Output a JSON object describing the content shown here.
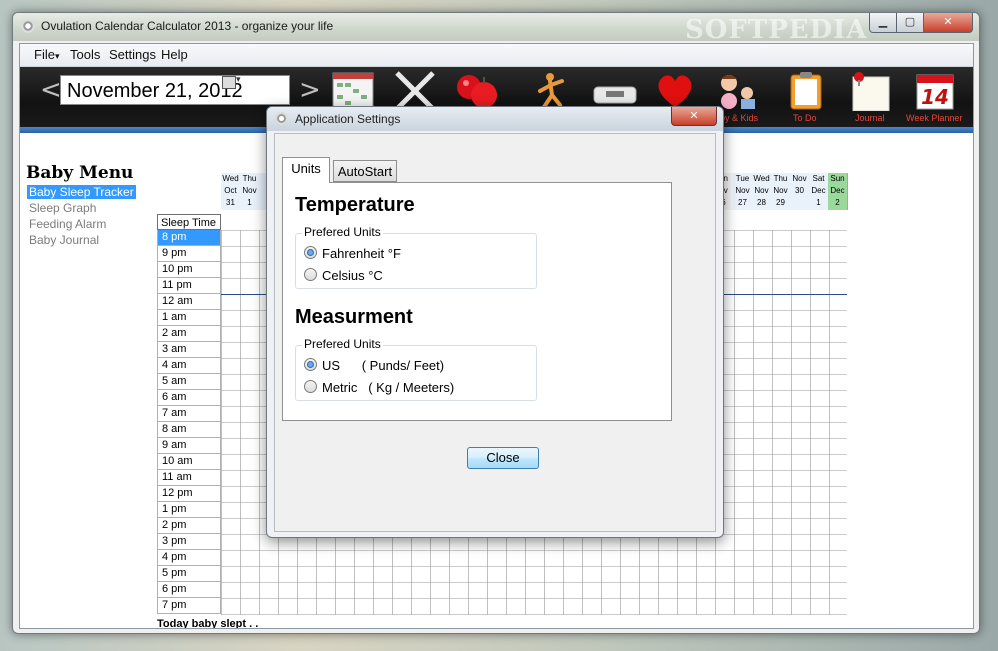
{
  "window": {
    "title": "Ovulation Calendar Calculator 2013 - organize your life",
    "watermark": "SOFTPEDIA",
    "controls": {
      "minimize": "▁",
      "maximize": "▢",
      "close": "✕"
    }
  },
  "menu": [
    "File",
    "Tools",
    "Settings",
    "Help"
  ],
  "file_arrow": "▾",
  "date_nav": {
    "prev": "<",
    "next": ">",
    "date": "November  21, 2012",
    "dropdown": "▾"
  },
  "toolbar": [
    {
      "icon": "calendar-grid-icon",
      "label": ""
    },
    {
      "icon": "cross-icon",
      "label": ""
    },
    {
      "icon": "apples-icon",
      "label": ""
    },
    {
      "icon": "exercise-figure-icon",
      "label": ""
    },
    {
      "icon": "scale-icon",
      "label": ""
    },
    {
      "icon": "heart-icon",
      "label": ""
    },
    {
      "icon": "baby-kids-icon",
      "label": "by & Kids"
    },
    {
      "icon": "clipboard-icon",
      "label": "To Do"
    },
    {
      "icon": "journal-icon",
      "label": "Journal"
    },
    {
      "icon": "week-planner-icon",
      "label": "Week Planner",
      "day": "14"
    }
  ],
  "baby_menu": {
    "title": "Baby Menu",
    "items": [
      "Baby Sleep Tracker",
      "Sleep Graph",
      "Feeding Alarm",
      "Baby Journal"
    ],
    "selected": 0
  },
  "grid": {
    "sleep_time_header": "Sleep Time",
    "left_days": [
      {
        "dow": "Wed",
        "mon": "Oct",
        "day": "31"
      },
      {
        "dow": "Thu",
        "mon": "Nov",
        "day": "1"
      },
      {
        "dow": "F",
        "mon": "N",
        "day": "2"
      }
    ],
    "right_days": [
      {
        "dow": "on",
        "mon": "ov",
        "day": "6"
      },
      {
        "dow": "Tue",
        "mon": "Nov",
        "day": "27"
      },
      {
        "dow": "Wed",
        "mon": "Nov",
        "day": "28"
      },
      {
        "dow": "Thu",
        "mon": "Nov",
        "day": "29"
      },
      {
        "dow": "",
        "mon": "Nov",
        "day": "30"
      },
      {
        "dow": "Sat",
        "mon": "Dec",
        "day": "1"
      },
      {
        "dow": "Sun",
        "mon": "Dec",
        "day": "2",
        "highlight": true
      }
    ],
    "times": [
      "8 pm",
      "9 pm",
      "10 pm",
      "11 pm",
      "12 am",
      "1 am",
      "2 am",
      "3 am",
      "4 am",
      "5 am",
      "6 am",
      "7 am",
      "8 am",
      "9 am",
      "10 am",
      "11 am",
      "12 pm",
      "1 pm",
      "2 pm",
      "3 pm",
      "4 pm",
      "5 pm",
      "6 pm",
      "7 pm"
    ],
    "selected_time": 0,
    "footer": "Today baby slept .                                          ."
  },
  "dialog": {
    "title": "Application Settings",
    "close_glyph": "✕",
    "tabs": [
      "Units",
      "AutoStart"
    ],
    "active_tab": 0,
    "temperature": {
      "heading": "Temperature",
      "group_label": "Prefered Units",
      "options": [
        "Fahrenheit °F",
        "Celsius °C"
      ],
      "selected": 0
    },
    "measurement": {
      "heading": "Measurment",
      "group_label": "Prefered Units",
      "options": [
        "US      ( Punds/ Feet)",
        "Metric   ( Kg / Meeters)"
      ],
      "selected": 0
    },
    "close_button": "Close"
  }
}
